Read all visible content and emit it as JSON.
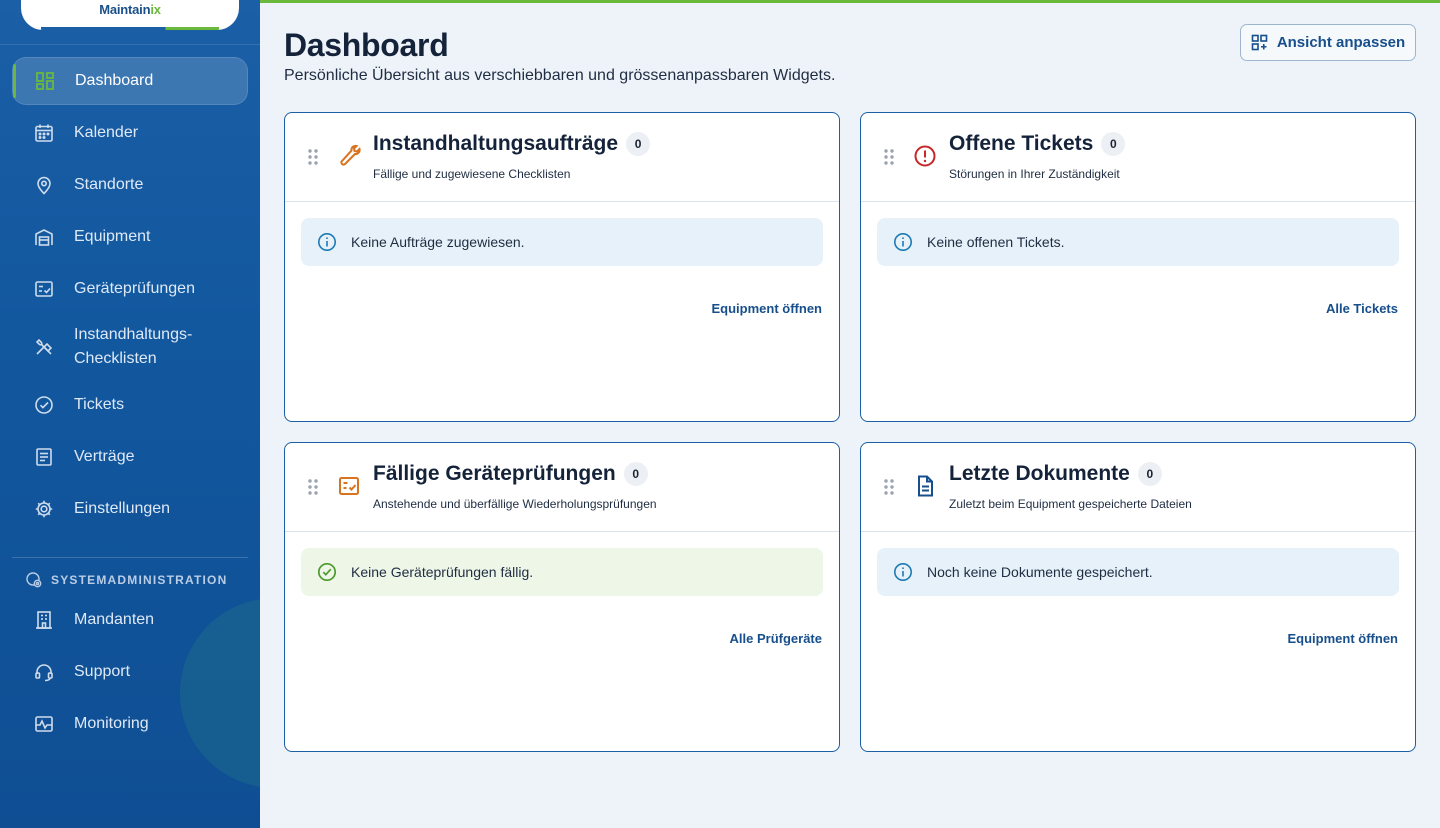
{
  "app": {
    "logo_main": "Maintain",
    "logo_accent": "ix"
  },
  "sidebar": {
    "items": [
      {
        "label": "Dashboard",
        "icon": "dashboard-icon",
        "active": true
      },
      {
        "label": "Kalender",
        "icon": "calendar-icon"
      },
      {
        "label": "Standorte",
        "icon": "location-pin-icon"
      },
      {
        "label": "Equipment",
        "icon": "warehouse-icon"
      },
      {
        "label": "Geräteprüfungen",
        "icon": "checklist-icon"
      },
      {
        "label": "Instandhaltungs-",
        "label2": "Checklisten",
        "icon": "tools-icon"
      },
      {
        "label": "Tickets",
        "icon": "check-circle-icon"
      },
      {
        "label": "Verträge",
        "icon": "document-icon"
      },
      {
        "label": "Einstellungen",
        "icon": "gear-icon"
      }
    ],
    "section_title": "SYSTEMADMINISTRATION",
    "admin_items": [
      {
        "label": "Mandanten",
        "icon": "building-icon"
      },
      {
        "label": "Support",
        "icon": "headset-icon"
      },
      {
        "label": "Monitoring",
        "icon": "monitoring-icon"
      }
    ]
  },
  "header": {
    "title": "Dashboard",
    "subtitle": "Persönliche Übersicht aus verschiebbaren und grössenanpassbaren Widgets.",
    "customize_label": "Ansicht anpassen"
  },
  "widgets": [
    {
      "title": "Instandhaltungsaufträge",
      "count": "0",
      "subtitle": "Fällige und zugewiesene Checklisten",
      "notice": "Keine Aufträge zugewiesen.",
      "notice_type": "info",
      "link": "Equipment öffnen",
      "icon": "wrench-icon",
      "icon_color": "#d9731f"
    },
    {
      "title": "Offene Tickets",
      "count": "0",
      "subtitle": "Störungen in Ihrer Zuständigkeit",
      "notice": "Keine offenen Tickets.",
      "notice_type": "info",
      "link": "Alle Tickets",
      "icon": "alert-circle-icon",
      "icon_color": "#c62828"
    },
    {
      "title": "Fällige Geräteprüfungen",
      "count": "0",
      "subtitle": "Anstehende und überfällige Wiederholungsprüfungen",
      "notice": "Keine Geräteprüfungen fällig.",
      "notice_type": "success",
      "link": "Alle Prüfgeräte",
      "icon": "checklist-icon",
      "icon_color": "#d9731f"
    },
    {
      "title": "Letzte Dokumente",
      "count": "0",
      "subtitle": "Zuletzt beim Equipment gespeicherte Dateien",
      "notice": "Noch keine Dokumente gespeichert.",
      "notice_type": "info",
      "link": "Equipment öffnen",
      "icon": "file-icon",
      "icon_color": "#174f8c"
    }
  ],
  "colors": {
    "brand": "#1b5fa6",
    "accent": "#6ab93c",
    "link": "#174f8c"
  }
}
